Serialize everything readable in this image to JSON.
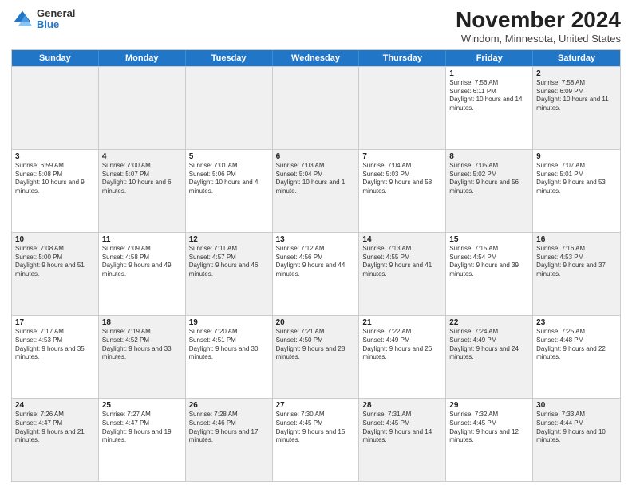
{
  "header": {
    "logo_general": "General",
    "logo_blue": "Blue",
    "title": "November 2024",
    "subtitle": "Windom, Minnesota, United States"
  },
  "weekdays": [
    "Sunday",
    "Monday",
    "Tuesday",
    "Wednesday",
    "Thursday",
    "Friday",
    "Saturday"
  ],
  "rows": [
    [
      {
        "day": "",
        "info": "",
        "shaded": true
      },
      {
        "day": "",
        "info": "",
        "shaded": true
      },
      {
        "day": "",
        "info": "",
        "shaded": true
      },
      {
        "day": "",
        "info": "",
        "shaded": true
      },
      {
        "day": "",
        "info": "",
        "shaded": true
      },
      {
        "day": "1",
        "info": "Sunrise: 7:56 AM\nSunset: 6:11 PM\nDaylight: 10 hours and 14 minutes.",
        "shaded": false
      },
      {
        "day": "2",
        "info": "Sunrise: 7:58 AM\nSunset: 6:09 PM\nDaylight: 10 hours and 11 minutes.",
        "shaded": true
      }
    ],
    [
      {
        "day": "3",
        "info": "Sunrise: 6:59 AM\nSunset: 5:08 PM\nDaylight: 10 hours and 9 minutes.",
        "shaded": false
      },
      {
        "day": "4",
        "info": "Sunrise: 7:00 AM\nSunset: 5:07 PM\nDaylight: 10 hours and 6 minutes.",
        "shaded": true
      },
      {
        "day": "5",
        "info": "Sunrise: 7:01 AM\nSunset: 5:06 PM\nDaylight: 10 hours and 4 minutes.",
        "shaded": false
      },
      {
        "day": "6",
        "info": "Sunrise: 7:03 AM\nSunset: 5:04 PM\nDaylight: 10 hours and 1 minute.",
        "shaded": true
      },
      {
        "day": "7",
        "info": "Sunrise: 7:04 AM\nSunset: 5:03 PM\nDaylight: 9 hours and 58 minutes.",
        "shaded": false
      },
      {
        "day": "8",
        "info": "Sunrise: 7:05 AM\nSunset: 5:02 PM\nDaylight: 9 hours and 56 minutes.",
        "shaded": true
      },
      {
        "day": "9",
        "info": "Sunrise: 7:07 AM\nSunset: 5:01 PM\nDaylight: 9 hours and 53 minutes.",
        "shaded": false
      }
    ],
    [
      {
        "day": "10",
        "info": "Sunrise: 7:08 AM\nSunset: 5:00 PM\nDaylight: 9 hours and 51 minutes.",
        "shaded": true
      },
      {
        "day": "11",
        "info": "Sunrise: 7:09 AM\nSunset: 4:58 PM\nDaylight: 9 hours and 49 minutes.",
        "shaded": false
      },
      {
        "day": "12",
        "info": "Sunrise: 7:11 AM\nSunset: 4:57 PM\nDaylight: 9 hours and 46 minutes.",
        "shaded": true
      },
      {
        "day": "13",
        "info": "Sunrise: 7:12 AM\nSunset: 4:56 PM\nDaylight: 9 hours and 44 minutes.",
        "shaded": false
      },
      {
        "day": "14",
        "info": "Sunrise: 7:13 AM\nSunset: 4:55 PM\nDaylight: 9 hours and 41 minutes.",
        "shaded": true
      },
      {
        "day": "15",
        "info": "Sunrise: 7:15 AM\nSunset: 4:54 PM\nDaylight: 9 hours and 39 minutes.",
        "shaded": false
      },
      {
        "day": "16",
        "info": "Sunrise: 7:16 AM\nSunset: 4:53 PM\nDaylight: 9 hours and 37 minutes.",
        "shaded": true
      }
    ],
    [
      {
        "day": "17",
        "info": "Sunrise: 7:17 AM\nSunset: 4:53 PM\nDaylight: 9 hours and 35 minutes.",
        "shaded": false
      },
      {
        "day": "18",
        "info": "Sunrise: 7:19 AM\nSunset: 4:52 PM\nDaylight: 9 hours and 33 minutes.",
        "shaded": true
      },
      {
        "day": "19",
        "info": "Sunrise: 7:20 AM\nSunset: 4:51 PM\nDaylight: 9 hours and 30 minutes.",
        "shaded": false
      },
      {
        "day": "20",
        "info": "Sunrise: 7:21 AM\nSunset: 4:50 PM\nDaylight: 9 hours and 28 minutes.",
        "shaded": true
      },
      {
        "day": "21",
        "info": "Sunrise: 7:22 AM\nSunset: 4:49 PM\nDaylight: 9 hours and 26 minutes.",
        "shaded": false
      },
      {
        "day": "22",
        "info": "Sunrise: 7:24 AM\nSunset: 4:49 PM\nDaylight: 9 hours and 24 minutes.",
        "shaded": true
      },
      {
        "day": "23",
        "info": "Sunrise: 7:25 AM\nSunset: 4:48 PM\nDaylight: 9 hours and 22 minutes.",
        "shaded": false
      }
    ],
    [
      {
        "day": "24",
        "info": "Sunrise: 7:26 AM\nSunset: 4:47 PM\nDaylight: 9 hours and 21 minutes.",
        "shaded": true
      },
      {
        "day": "25",
        "info": "Sunrise: 7:27 AM\nSunset: 4:47 PM\nDaylight: 9 hours and 19 minutes.",
        "shaded": false
      },
      {
        "day": "26",
        "info": "Sunrise: 7:28 AM\nSunset: 4:46 PM\nDaylight: 9 hours and 17 minutes.",
        "shaded": true
      },
      {
        "day": "27",
        "info": "Sunrise: 7:30 AM\nSunset: 4:45 PM\nDaylight: 9 hours and 15 minutes.",
        "shaded": false
      },
      {
        "day": "28",
        "info": "Sunrise: 7:31 AM\nSunset: 4:45 PM\nDaylight: 9 hours and 14 minutes.",
        "shaded": true
      },
      {
        "day": "29",
        "info": "Sunrise: 7:32 AM\nSunset: 4:45 PM\nDaylight: 9 hours and 12 minutes.",
        "shaded": false
      },
      {
        "day": "30",
        "info": "Sunrise: 7:33 AM\nSunset: 4:44 PM\nDaylight: 9 hours and 10 minutes.",
        "shaded": true
      }
    ]
  ]
}
